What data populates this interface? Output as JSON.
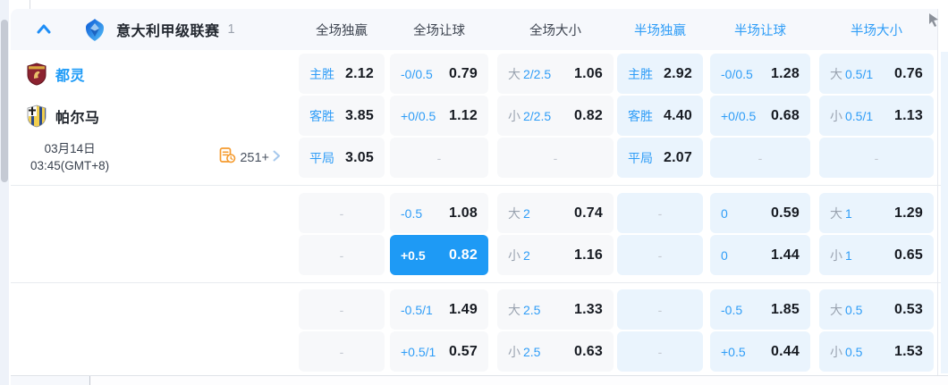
{
  "league_header": {
    "name": "意大利甲级联赛",
    "count": "1",
    "columns": [
      {
        "label": "全场独赢"
      },
      {
        "label": "全场让球"
      },
      {
        "label": "全场大小"
      },
      {
        "label": "半场独赢"
      },
      {
        "label": "半场让球"
      },
      {
        "label": "半场大小"
      }
    ]
  },
  "match": {
    "home_team": "都灵",
    "away_team": "帕尔马",
    "date": "03月14日",
    "time": "03:45(GMT+8)",
    "more_markets": "251+"
  },
  "odds_sections": [
    {
      "rows": [
        {
          "left": "home",
          "cells": [
            {
              "label": "主胜",
              "value": "2.12"
            },
            {
              "label": "-0/0.5",
              "value": "0.79"
            },
            {
              "prefix": "大",
              "label": "2/2.5",
              "value": "1.06"
            },
            {
              "label": "主胜",
              "value": "2.92"
            },
            {
              "label": "-0/0.5",
              "value": "1.28"
            },
            {
              "prefix": "大",
              "label": "0.5/1",
              "value": "0.76"
            }
          ]
        },
        {
          "left": "away",
          "cells": [
            {
              "label": "客胜",
              "value": "3.85"
            },
            {
              "label": "+0/0.5",
              "value": "1.12"
            },
            {
              "prefix": "小",
              "label": "2/2.5",
              "value": "0.82"
            },
            {
              "label": "客胜",
              "value": "4.40"
            },
            {
              "label": "+0/0.5",
              "value": "0.68"
            },
            {
              "prefix": "小",
              "label": "0.5/1",
              "value": "1.13"
            }
          ]
        },
        {
          "left": "datetime",
          "cells": [
            {
              "label": "平局",
              "value": "3.05"
            },
            {
              "dash": "-"
            },
            {
              "dash": "-"
            },
            {
              "label": "平局",
              "value": "2.07"
            },
            {
              "dash": "-"
            },
            {
              "dash": "-"
            }
          ]
        }
      ]
    },
    {
      "rows": [
        {
          "cells": [
            {
              "dash": "-"
            },
            {
              "label": "-0.5",
              "value": "1.08"
            },
            {
              "prefix": "大",
              "label": "2",
              "value": "0.74"
            },
            {
              "dash": "-"
            },
            {
              "label": "0",
              "value": "0.59"
            },
            {
              "prefix": "大",
              "label": "1",
              "value": "1.29"
            }
          ]
        },
        {
          "cells": [
            {
              "dash": "-"
            },
            {
              "label": "+0.5",
              "value": "0.82",
              "highlighted": true
            },
            {
              "prefix": "小",
              "label": "2",
              "value": "1.16"
            },
            {
              "dash": "-"
            },
            {
              "label": "0",
              "value": "1.44"
            },
            {
              "prefix": "小",
              "label": "1",
              "value": "0.65"
            }
          ]
        }
      ]
    },
    {
      "rows": [
        {
          "cells": [
            {
              "dash": "-"
            },
            {
              "label": "-0.5/1",
              "value": "1.49"
            },
            {
              "prefix": "大",
              "label": "2.5",
              "value": "1.33"
            },
            {
              "dash": "-"
            },
            {
              "label": "-0.5",
              "value": "1.85"
            },
            {
              "prefix": "大",
              "label": "0.5",
              "value": "0.53"
            }
          ]
        },
        {
          "cells": [
            {
              "dash": "-"
            },
            {
              "label": "+0.5/1",
              "value": "0.57"
            },
            {
              "prefix": "小",
              "label": "2.5",
              "value": "0.63"
            },
            {
              "dash": "-"
            },
            {
              "label": "+0.5",
              "value": "0.44"
            },
            {
              "prefix": "小",
              "label": "0.5",
              "value": "1.53"
            }
          ]
        }
      ]
    }
  ],
  "icons": {
    "collapse": "chevron-up-icon",
    "league": "serie-a-logo-icon",
    "home_crest": "torino-crest-icon",
    "away_crest": "parma-crest-icon",
    "markets": "markets-doc-icon",
    "markets_arrow": "chevron-right-icon",
    "cursor": "mouse-cursor-icon"
  },
  "colors": {
    "accent_blue": "#2f9df7",
    "highlight_bg": "#1e9af5",
    "full_cell_bg": "#f7f8fa",
    "half_cell_bg": "#eaf4fd",
    "header_bg": "#f6f8fc",
    "odds_text": "#171b22",
    "markets_orange": "#f59b2f"
  }
}
